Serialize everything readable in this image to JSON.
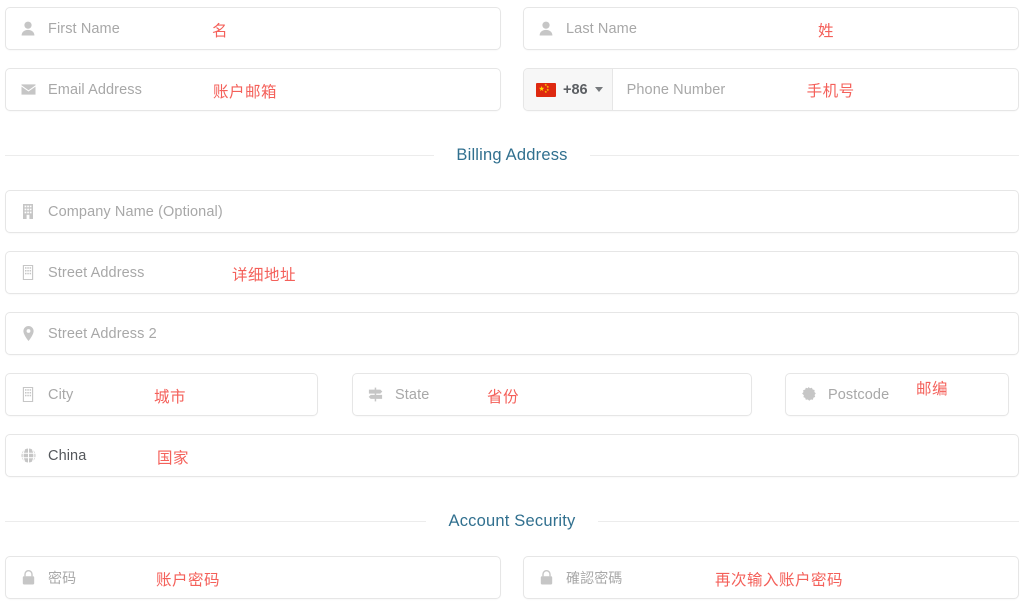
{
  "colors": {
    "annotation_red": "#f4605a",
    "section_blue": "#31708f",
    "placeholder_grey": "#a8a8a8",
    "icon_grey": "#c6c6c6",
    "border_grey": "#e6e6e6",
    "flag_red": "#de2910",
    "flag_yellow": "#ffde00"
  },
  "personal": {
    "first_name": {
      "placeholder": "First Name",
      "annotation": "名",
      "icon": "user-icon"
    },
    "last_name": {
      "placeholder": "Last Name",
      "annotation": "姓",
      "icon": "user-icon"
    },
    "email": {
      "placeholder": "Email Address",
      "annotation": "账户邮箱",
      "icon": "envelope-icon"
    },
    "phone": {
      "placeholder": "Phone Number",
      "annotation": "手机号",
      "country_code": "+86",
      "flag": "china-flag-icon"
    }
  },
  "billing": {
    "section_title": "Billing Address",
    "company": {
      "placeholder": "Company Name (Optional)",
      "annotation": "",
      "icon": "building-icon"
    },
    "street": {
      "placeholder": "Street Address",
      "annotation": "详细地址",
      "icon": "building-outline-icon"
    },
    "street2": {
      "placeholder": "Street Address 2",
      "annotation": "",
      "icon": "map-pin-icon"
    },
    "city": {
      "placeholder": "City",
      "annotation": "城市",
      "icon": "building-outline-icon"
    },
    "state": {
      "placeholder": "State",
      "annotation": "省份",
      "icon": "signpost-icon"
    },
    "postcode": {
      "placeholder": "Postcode",
      "annotation": "邮编",
      "icon": "seal-icon"
    },
    "country": {
      "value": "China",
      "annotation": "国家",
      "icon": "globe-icon"
    }
  },
  "security": {
    "section_title": "Account Security",
    "password": {
      "placeholder": "密码",
      "annotation": "账户密码",
      "icon": "lock-icon"
    },
    "confirm": {
      "placeholder": "確認密碼",
      "annotation": "再次输入账户密码",
      "icon": "lock-icon"
    }
  }
}
